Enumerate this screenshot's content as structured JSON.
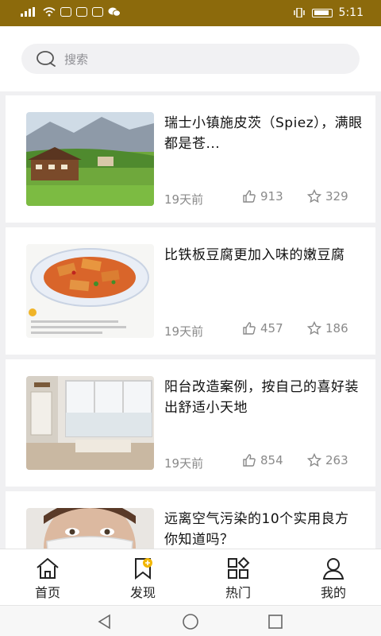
{
  "status": {
    "left_icons": "signal-wifi-notifications",
    "time": "5:11"
  },
  "search": {
    "placeholder": "搜索"
  },
  "articles": [
    {
      "title": "瑞士小镇施皮茨（Spiez），满眼都是苍...",
      "age": "19天前",
      "likes": "913",
      "favorites": "329",
      "image": "village-landscape"
    },
    {
      "title": "比铁板豆腐更加入味的嫩豆腐",
      "age": "19天前",
      "likes": "457",
      "favorites": "186",
      "image": "tofu-dish"
    },
    {
      "title": "阳台改造案例，按自己的喜好装出舒适小天地",
      "age": "19天前",
      "likes": "854",
      "favorites": "263",
      "image": "balcony-room"
    },
    {
      "title": "远离空气污染的10个实用良方 你知道吗？",
      "age": "",
      "likes": "",
      "favorites": "",
      "image": "face-mask"
    }
  ],
  "tabs": [
    {
      "label": "首页",
      "icon": "home-icon"
    },
    {
      "label": "发现",
      "icon": "discover-bookmark-icon"
    },
    {
      "label": "热门",
      "icon": "popular-grid-icon"
    },
    {
      "label": "我的",
      "icon": "profile-icon"
    }
  ],
  "colors": {
    "status_bar": "#8c6a0c",
    "accent": "#f2b705"
  }
}
